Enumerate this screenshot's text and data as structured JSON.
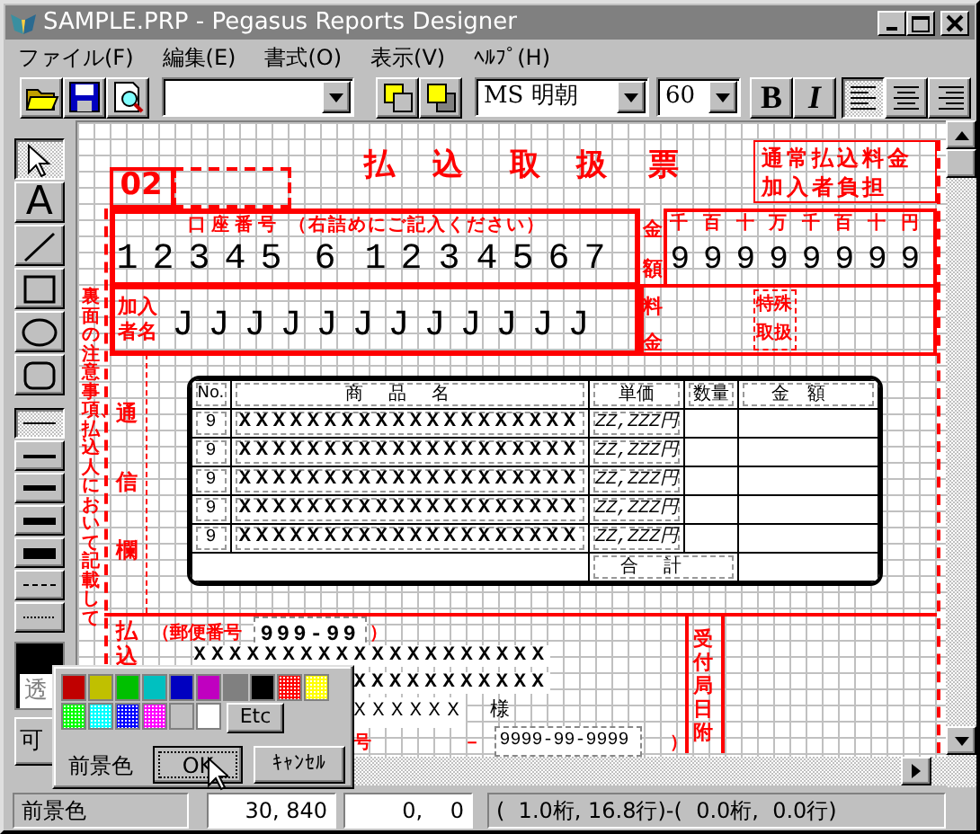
{
  "window": {
    "title": "SAMPLE.PRP - Pegasus Reports Designer"
  },
  "menu": [
    "ファイル(F)",
    "編集(E)",
    "書式(O)",
    "表示(V)",
    "ﾍﾙﾌﾟ(H)"
  ],
  "toolbar": {
    "file_buttons": [
      {
        "kind": "open"
      },
      {
        "kind": "save"
      },
      {
        "kind": "preview"
      }
    ],
    "order_buttons": [
      {
        "kind": "front"
      },
      {
        "kind": "back"
      }
    ],
    "font": "MS 明朝",
    "font_size": "60",
    "style_buttons": [
      {
        "kind": "bold",
        "label": "B",
        "selected": false
      },
      {
        "kind": "italic",
        "label": "I",
        "selected": false
      }
    ],
    "align_buttons": [
      {
        "kind": "left",
        "selected": true
      },
      {
        "kind": "center",
        "selected": false
      },
      {
        "kind": "right",
        "selected": false
      }
    ]
  },
  "toolbox": {
    "tools": [
      {
        "kind": "select",
        "selected": true
      },
      {
        "kind": "text",
        "label": "A",
        "selected": false
      },
      {
        "kind": "line",
        "selected": false
      },
      {
        "kind": "rectangle",
        "selected": false
      },
      {
        "kind": "ellipse",
        "selected": false
      },
      {
        "kind": "rounded",
        "selected": false
      }
    ],
    "line_styles": [
      {
        "kind": "hairline",
        "selected": true
      },
      {
        "kind": "thin",
        "selected": false
      },
      {
        "kind": "medium",
        "selected": false
      },
      {
        "kind": "thick",
        "selected": false
      },
      {
        "kind": "heavy",
        "selected": false
      },
      {
        "kind": "dashed",
        "selected": false
      },
      {
        "kind": "dotted",
        "selected": false
      }
    ],
    "color": {
      "color": "#000000",
      "label": "透"
    },
    "visible_button": "可"
  },
  "form": {
    "number": "02",
    "title": [
      "払",
      "込",
      "取",
      "扱",
      "票"
    ],
    "fee_note": [
      "通常払込料金",
      "加入者負担"
    ],
    "account_heading": "口座番号",
    "account_note": "（右詰めにご記入ください）",
    "account_digits": [
      "1",
      "2",
      "3",
      "4",
      "5",
      "6",
      "1",
      "2",
      "3",
      "4",
      "5",
      "6",
      "7"
    ],
    "amount_label": "金額",
    "amount_places": [
      "千",
      "百",
      "十",
      "万",
      "千",
      "百",
      "十",
      "円"
    ],
    "amount_digits": [
      "9",
      "9",
      "9",
      "9",
      "9",
      "9",
      "9",
      "9"
    ],
    "subscriber_label": "加入者名",
    "subscriber_chars": [
      "J",
      "J",
      "J",
      "J",
      "J",
      "J",
      "J",
      "J",
      "J",
      "J",
      "J",
      "J"
    ],
    "fee_label": "料金",
    "special_label": "特殊取扱",
    "side_note": "裏面の注意事項、払込人において記載して",
    "message_label": "通信欄",
    "table": {
      "columns": [
        "No.",
        "商品名",
        "単価",
        "数量",
        "金額"
      ],
      "rows": [
        {
          "no": "9",
          "item": "XXXXXXXXXXXXXXXXXXXX",
          "price": "ZZ,ZZZ円"
        },
        {
          "no": "9",
          "item": "XXXXXXXXXXXXXXXXXXXX",
          "price": "ZZ,ZZZ円"
        },
        {
          "no": "9",
          "item": "XXXXXXXXXXXXXXXXXXXX",
          "price": "ZZ,ZZZ円"
        },
        {
          "no": "9",
          "item": "XXXXXXXXXXXXXXXXXXXX",
          "price": "ZZ,ZZZ円"
        },
        {
          "no": "9",
          "item": "XXXXXXXXXXXXXXXXXXXX",
          "price": "ZZ,ZZZ円"
        }
      ],
      "total_label": "合計"
    },
    "payer_label": "払込",
    "postal_label": "（郵便番号",
    "postal_code": "999-99",
    "postal_close": "）",
    "address_lines": [
      "XXXXXXXXXXXXXXXXXXXX",
      "XXXXXXXXXXX"
    ],
    "payer_name": "XXXXXX",
    "honorific": "様",
    "phone_label": "号",
    "phone_dash": "－",
    "phone": "9999-99-9999",
    "phone_close": "）",
    "receipt_label": "受付局日附"
  },
  "color_popup": {
    "swatches": [
      {
        "kind": "solid",
        "color": "#c00000"
      },
      {
        "kind": "solid",
        "color": "#c0c000"
      },
      {
        "kind": "solid",
        "color": "#00c000"
      },
      {
        "kind": "solid",
        "color": "#00c0c0"
      },
      {
        "kind": "solid",
        "color": "#0000c0"
      },
      {
        "kind": "solid",
        "color": "#c000c0"
      },
      {
        "kind": "solid",
        "color": "#808080"
      },
      {
        "kind": "solid",
        "color": "#000000"
      },
      {
        "kind": "dither",
        "color": "#ff0000"
      },
      {
        "kind": "dither",
        "color": "#ffff00"
      },
      {
        "kind": "dither",
        "color": "#00ff00"
      },
      {
        "kind": "dither",
        "color": "#00ffff"
      },
      {
        "kind": "dither",
        "color": "#0000ff"
      },
      {
        "kind": "dither",
        "color": "#ff00ff"
      },
      {
        "kind": "solid",
        "color": "#c0c0c0"
      },
      {
        "kind": "solid",
        "color": "#ffffff"
      }
    ],
    "more": "Etc",
    "label": "前景色",
    "ok": "OK",
    "cancel": "ｷｬﾝｾﾙ"
  },
  "status_bar": [
    "前景色",
    "30, 840",
    "0,    0",
    "(  1.0桁, 16.8行)-(  0.0桁,  0.0行)"
  ]
}
